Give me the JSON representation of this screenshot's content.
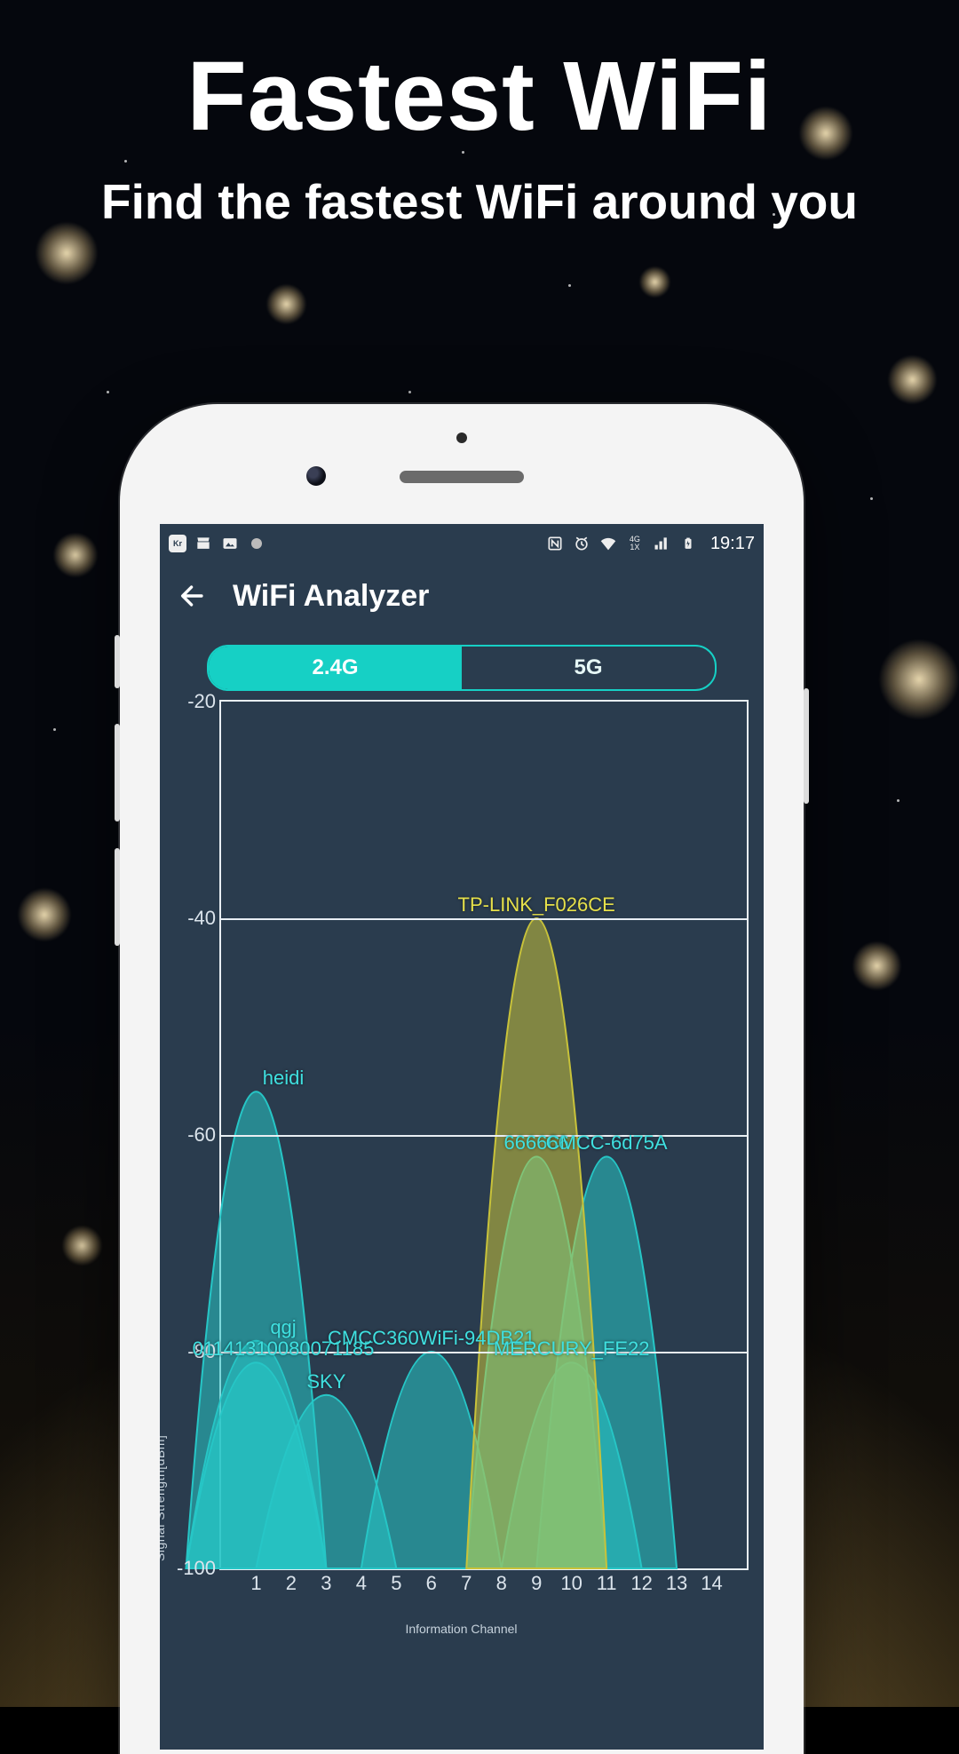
{
  "promo": {
    "title": "Fastest WiFi",
    "subtitle": "Find the fastest WiFi around you"
  },
  "status_bar": {
    "time": "19:17",
    "left_icons": [
      "Kr",
      "store-icon",
      "image-icon",
      "circle-icon"
    ],
    "right_icons": [
      "nfc-icon",
      "alarm-icon",
      "wifi-icon",
      "4g-signal-icon",
      "signal-icon",
      "battery-charging-icon"
    ]
  },
  "app_bar": {
    "title": "WiFi Analyzer"
  },
  "band_toggle": {
    "options": [
      "2.4G",
      "5G"
    ],
    "active_index": 0
  },
  "chart_data": {
    "type": "area",
    "xlabel": "Information Channel",
    "ylabel": "Signal Strength[dBm]",
    "ylim": [
      -100,
      -20
    ],
    "y_ticks": [
      -20,
      -40,
      -60,
      -80,
      -100
    ],
    "x_ticks": [
      1,
      2,
      3,
      4,
      5,
      6,
      7,
      8,
      9,
      10,
      11,
      12,
      13,
      14
    ],
    "channel_half_width": 2,
    "series": [
      {
        "name": "heidi",
        "channel": 1,
        "peak_dbm": -56,
        "color": "#26c6c6"
      },
      {
        "name": "qgj",
        "channel": 1,
        "peak_dbm": -79,
        "color": "#26c6c6"
      },
      {
        "name": "01141310080071185",
        "channel": 1,
        "peak_dbm": -81,
        "color": "#26c6c6"
      },
      {
        "name": "SKY",
        "channel": 3,
        "peak_dbm": -84,
        "color": "#26c6c6"
      },
      {
        "name": "CMCC360WiFi-94DB21",
        "channel": 6,
        "peak_dbm": -80,
        "color": "#26c6c6"
      },
      {
        "name": "TP-LINK_F026CE",
        "channel": 9,
        "peak_dbm": -40,
        "color": "#c8c23a"
      },
      {
        "name": "666666",
        "channel": 9,
        "peak_dbm": -62,
        "color": "#26c6c6"
      },
      {
        "name": "CMCC-6d75A",
        "channel": 11,
        "peak_dbm": -62,
        "color": "#26c6c6"
      },
      {
        "name": "MERCURY_FE22",
        "channel": 10,
        "peak_dbm": -81,
        "color": "#26c6c6"
      }
    ]
  },
  "colors": {
    "accent": "#16d0c5",
    "screen_bg": "#2a3c4e"
  }
}
